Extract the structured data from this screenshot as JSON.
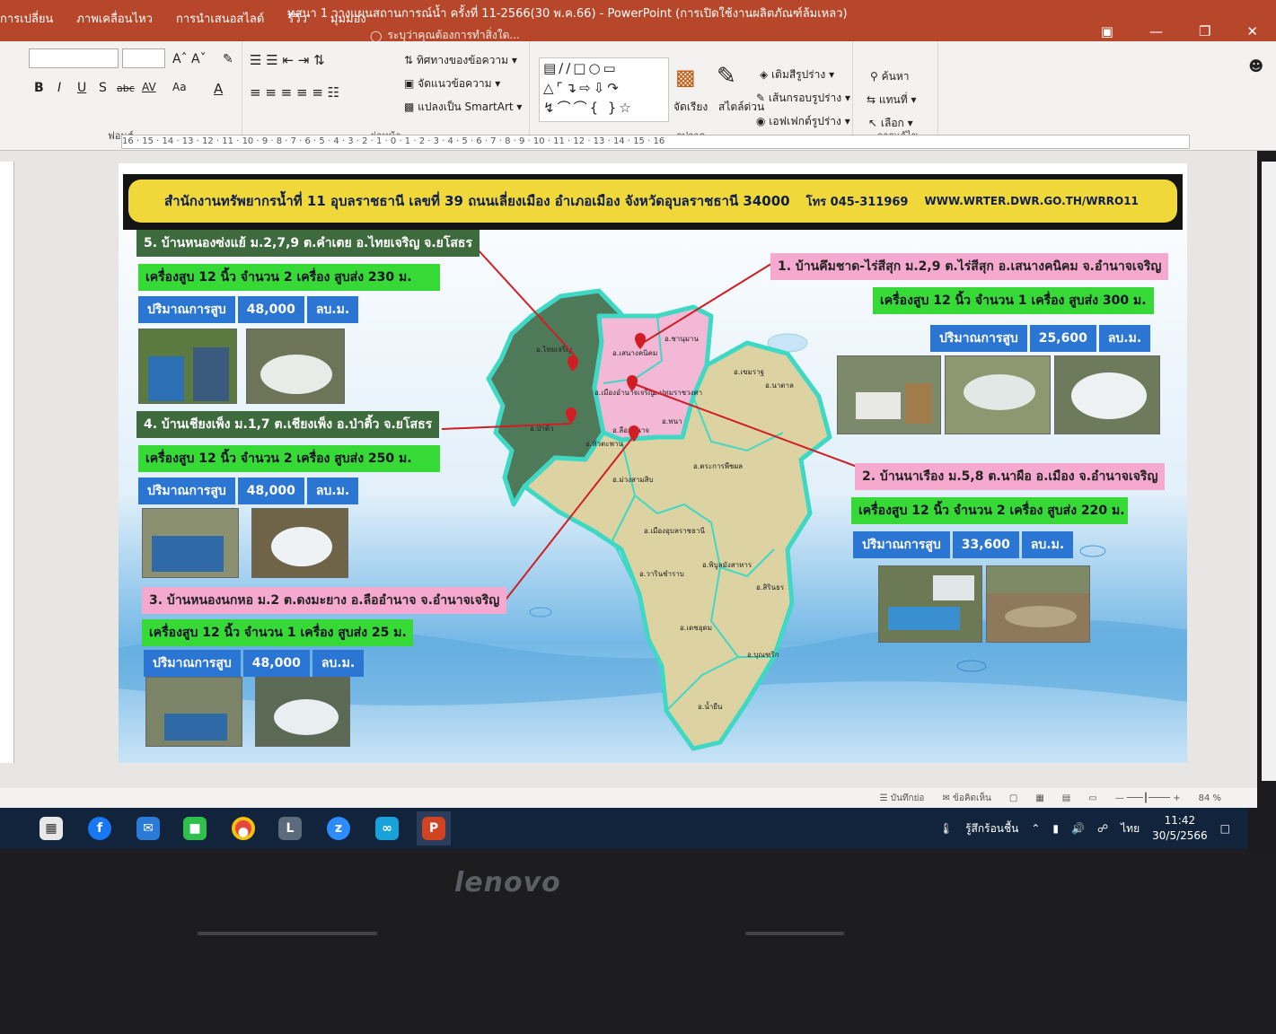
{
  "window": {
    "title": "ทสนา 1 วางแผนสถานการณ์น้ำ ครั้งที่ 11-2566(30 พ.ค.66) - PowerPoint (การเปิดใช้งานผลิตภัณฑ์ล้มเหลว)",
    "tabs": [
      "การเปลี่ยน",
      "ภาพเคลื่อนไหว",
      "การนำเสนอสไลด์",
      "รีวิว",
      "มุมมอง"
    ],
    "tell_me": "ระบุว่าคุณต้องการทำสิ่งใด..."
  },
  "ribbon": {
    "font_group": "ฟอนต์",
    "paragraph_group": "ย่อหน้า",
    "drawing_group": "รูปวาด",
    "editing_group": "การแก้ไข",
    "text_direction": "ทิศทางของข้อความ",
    "align_text": "จัดแนวข้อความ",
    "convert_smartart": "แปลงเป็น SmartArt",
    "arrange": "จัดเรียง",
    "quick_styles": "สไตล์ด่วน",
    "shape_fill": "เติมสีรูปร่าง",
    "shape_outline": "เส้นกรอบรูปร่าง",
    "shape_effects": "เอฟเฟกต์รูปร่าง",
    "find": "ค้นหา",
    "replace": "แทนที่",
    "select": "เลือก",
    "format_buttons": [
      "B",
      "I",
      "U",
      "S",
      "abc",
      "AV",
      "Aa",
      "A"
    ]
  },
  "ruler": "16 · 15 · 14 · 13 · 12 · 11 · 10 · 9 · 8 · 7 · 6 · 5 · 4 · 3 · 2 · 1 · 0 · 1 · 2 · 3 · 4 · 5 · 6 · 7 · 8 · 9 · 10 · 11 · 12 · 13 · 14 · 15 · 16",
  "slide": {
    "header": {
      "office": "สำนักงานทรัพยากรน้ำที่  11 อุบลราชธานี  เลขที่ 39 ถนนเลี่ยงเมือง  อำเภอเมือง  จังหวัดอุบลราชธานี 34000",
      "tel": "โทร 045-311969",
      "web": "WWW.WRTER.DWR.GO.TH/WRRO11"
    },
    "sites": [
      {
        "title": "5. บ้านหนองซ่งแย้ ม.2,7,9  ต.คำเตย อ.ไทยเจริญ จ.ยโสธร",
        "pump": "เครื่องสูบ 12 นิ้ว  จำนวน 2 เครื่อง สูบส่ง 230 ม.",
        "amount_label": "ปริมาณการสูบ",
        "amount": "48,000",
        "unit": "ลบ.ม."
      },
      {
        "title": "4. บ้านเชียงเพ็ง ม.1,7  ต.เชียงเพ็ง อ.ป่าติ้ว จ.ยโสธร",
        "pump": "เครื่องสูบ 12 นิ้ว  จำนวน 2 เครื่อง สูบส่ง 250 ม.",
        "amount_label": "ปริมาณการสูบ",
        "amount": "48,000",
        "unit": "ลบ.ม."
      },
      {
        "title": "3. บ้านหนองนกหอ ม.2  ต.ดงมะยาง อ.ลืออำนาจ จ.อำนาจเจริญ",
        "pump": "เครื่องสูบ 12 นิ้ว  จำนวน 1 เครื่อง สูบส่ง 25 ม.",
        "amount_label": "ปริมาณการสูบ",
        "amount": "48,000",
        "unit": "ลบ.ม."
      },
      {
        "title": "1. บ้านคึมชาด-ไร่สีสุก ม.2,9  ต.ไร่สีสุก  อ.เสนางคนิคม  จ.อำนาจเจริญ",
        "pump": "เครื่องสูบ 12 นิ้ว  จำนวน 1 เครื่อง สูบส่ง 300 ม.",
        "amount_label": "ปริมาณการสูบ",
        "amount": "25,600",
        "unit": "ลบ.ม."
      },
      {
        "title": "2. บ้านนาเรือง ม.5,8  ต.นาผือ อ.เมือง จ.อำนาจเจริญ",
        "pump": "เครื่องสูบ 12 นิ้ว  จำนวน 2 เครื่อง สูบส่ง 220 ม.",
        "amount_label": "ปริมาณการสูบ",
        "amount": "33,600",
        "unit": "ลบ.ม."
      }
    ],
    "map_districts": [
      "อ.เสนางคนิคม",
      "อ.ชานุมาน",
      "อ.ปทุมราชวงศา",
      "อ.พนา",
      "อ.เมืองอำนาจเจริญ",
      "อ.ลืออำนาจ",
      "อ.หัวตะพาน",
      "อ.ป่าติ้ว",
      "อ.ไทยเจริญ",
      "อ.เขมราฐ",
      "อ.นาตาล",
      "อ.ตระการพืชผล",
      "อ.ม่วงสามสิบ",
      "อ.เมืองอุบลราชธานี",
      "อ.วารินชำราบ",
      "อ.สิรินธร",
      "อ.พิบูลมังสาหาร",
      "อ.เดชอุดม",
      "อ.บุณฑริก",
      "อ.น้ำยืน"
    ]
  },
  "statusbar": {
    "notes": "บันทึกย่อ",
    "comments": "ข้อคิดเห็น",
    "zoom": "84 %"
  },
  "taskbar": {
    "weather": "รู้สึกร้อนชื้น",
    "lang": "ไทย",
    "time": "11:42",
    "date": "30/5/2566"
  },
  "laptop": {
    "brand": "lenovo"
  },
  "colors": {
    "ppt_red": "#b7472a",
    "header_yellow": "#f0d73a",
    "label_green": "#37d937",
    "stat_blue": "#2b76d2",
    "label_pink": "#f5a9cf",
    "label_dark": "#3d6b3e",
    "map_tan": "#ddd3a2",
    "map_dark": "#4f7a5a",
    "map_pink": "#f3b8d6",
    "map_border": "#3fd8c4"
  }
}
